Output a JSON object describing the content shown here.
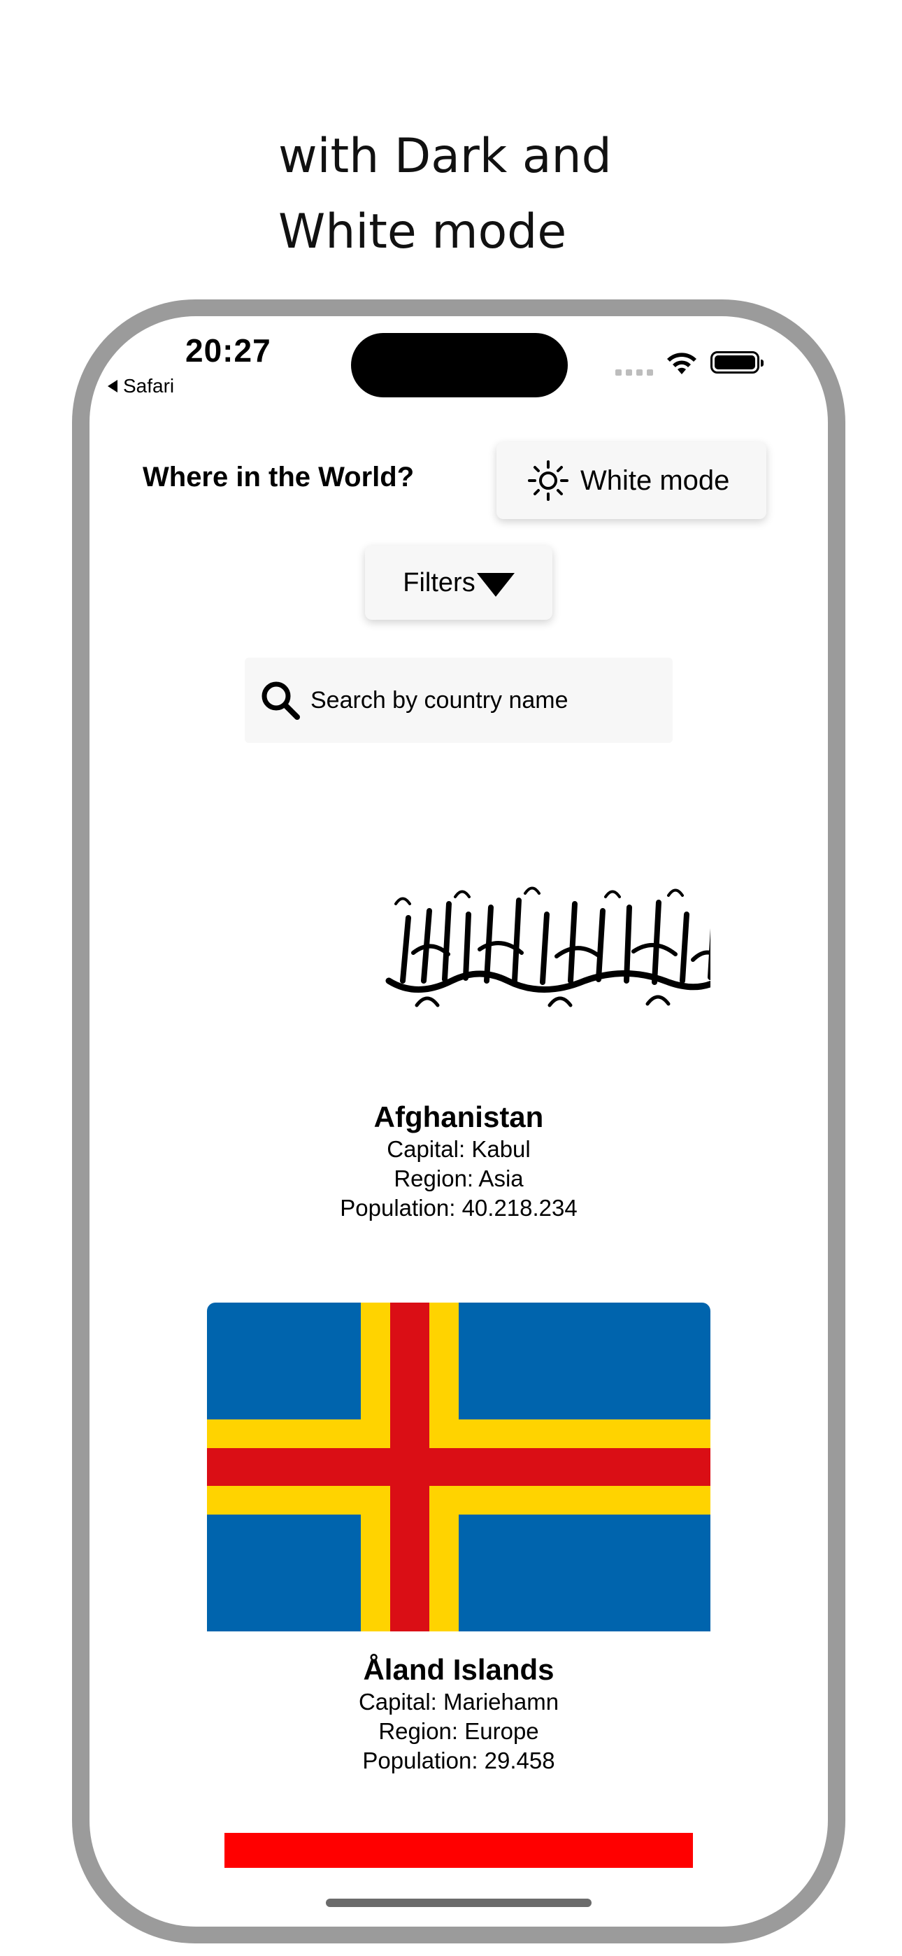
{
  "caption": {
    "line1": "with Dark and",
    "line2": "White mode"
  },
  "status_bar": {
    "time": "20:27",
    "back_label": "Safari"
  },
  "header": {
    "title": "Where in the World?",
    "mode_button_label": "White mode",
    "mode_icon": "sun-icon"
  },
  "filters": {
    "label": "Filters",
    "icon": "caret-down-icon"
  },
  "search": {
    "placeholder": "Search by country name",
    "icon": "search-icon"
  },
  "countries": [
    {
      "name": "Afghanistan",
      "capital": "Capital: Kabul",
      "region": "Region: Asia",
      "population": "Population: 40.218.234"
    },
    {
      "name": "Åland Islands",
      "capital": "Capital: Mariehamn",
      "region": "Region: Europe",
      "population": "Population: 29.458",
      "flag_colors": {
        "blue": "#0064ad",
        "yellow": "#ffd300",
        "red": "#da0e15"
      }
    }
  ],
  "next_flag_color": "#ff0000"
}
